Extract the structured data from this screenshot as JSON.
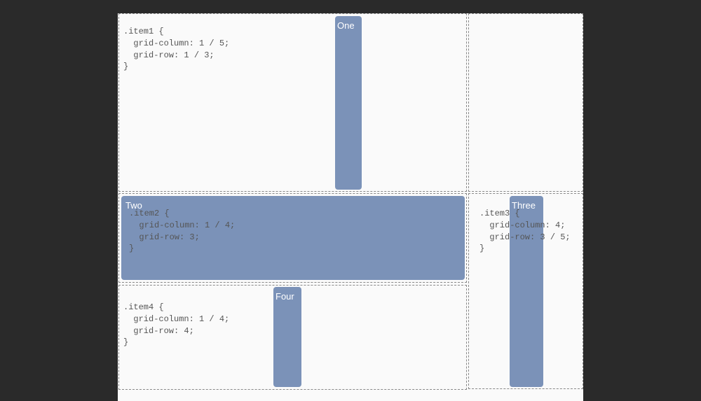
{
  "labels": {
    "one": "One",
    "two": "Two",
    "three": "Three",
    "four": "Four"
  },
  "code": {
    "item1": ".item1 {\n  grid-column: 1 / 5;\n  grid-row: 1 / 3;\n}",
    "item2": ".item2 {\n  grid-column: 1 / 4;\n  grid-row: 3;\n}",
    "item3": ".item3 {\n  grid-column: 4;\n  grid-row: 3 / 5;\n}",
    "item4": ".item4 {\n  grid-column: 1 / 4;\n  grid-row: 4;\n}"
  }
}
